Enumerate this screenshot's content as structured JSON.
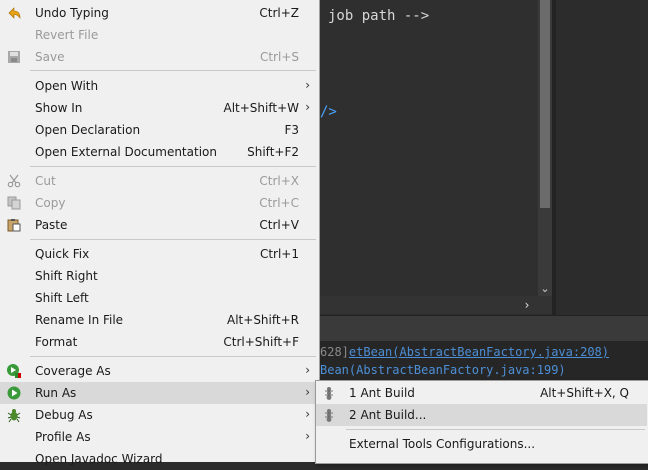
{
  "editor": {
    "code_line": "job path -->",
    "code_fragment": "/>"
  },
  "console": {
    "line1_prefix": "628]",
    "line1_link": "etBean(AbstractBeanFactory.java:208)",
    "line2": "Bean(AbstractBeanFactory.java:199)"
  },
  "menu": {
    "items": [
      {
        "label": "Undo Typing",
        "shortcut": "Ctrl+Z",
        "icon": "undo-icon"
      },
      {
        "label": "Revert File",
        "shortcut": "",
        "icon": ""
      },
      {
        "label": "Save",
        "shortcut": "Ctrl+S",
        "icon": "save-icon"
      },
      {
        "label": "Open With",
        "shortcut": "",
        "icon": ""
      },
      {
        "label": "Show In",
        "shortcut": "Alt+Shift+W",
        "icon": ""
      },
      {
        "label": "Open Declaration",
        "shortcut": "F3",
        "icon": ""
      },
      {
        "label": "Open External Documentation",
        "shortcut": "Shift+F2",
        "icon": ""
      },
      {
        "label": "Cut",
        "shortcut": "Ctrl+X",
        "icon": "cut-icon"
      },
      {
        "label": "Copy",
        "shortcut": "Ctrl+C",
        "icon": "copy-icon"
      },
      {
        "label": "Paste",
        "shortcut": "Ctrl+V",
        "icon": "paste-icon"
      },
      {
        "label": "Quick Fix",
        "shortcut": "Ctrl+1",
        "icon": ""
      },
      {
        "label": "Shift Right",
        "shortcut": "",
        "icon": ""
      },
      {
        "label": "Shift Left",
        "shortcut": "",
        "icon": ""
      },
      {
        "label": "Rename In File",
        "shortcut": "Alt+Shift+R",
        "icon": ""
      },
      {
        "label": "Format",
        "shortcut": "Ctrl+Shift+F",
        "icon": ""
      },
      {
        "label": "Coverage As",
        "shortcut": "",
        "icon": "coverage-icon"
      },
      {
        "label": "Run As",
        "shortcut": "",
        "icon": "run-icon"
      },
      {
        "label": "Debug As",
        "shortcut": "",
        "icon": "debug-icon"
      },
      {
        "label": "Profile As",
        "shortcut": "",
        "icon": ""
      },
      {
        "label": "Open Javadoc Wizard",
        "shortcut": "",
        "icon": ""
      }
    ]
  },
  "submenu": {
    "items": [
      {
        "label": "1 Ant Build",
        "shortcut": "Alt+Shift+X, Q",
        "icon": "ant-icon"
      },
      {
        "label": "2 Ant Build...",
        "shortcut": "",
        "icon": "ant-icon"
      },
      {
        "label": "External Tools Configurations...",
        "shortcut": "",
        "icon": ""
      }
    ]
  },
  "colors": {
    "menu_bg": "#f0f0f0",
    "highlight": "#d9d9d9",
    "editor_bg": "#2f2f2f",
    "link": "#4d8fd6"
  }
}
